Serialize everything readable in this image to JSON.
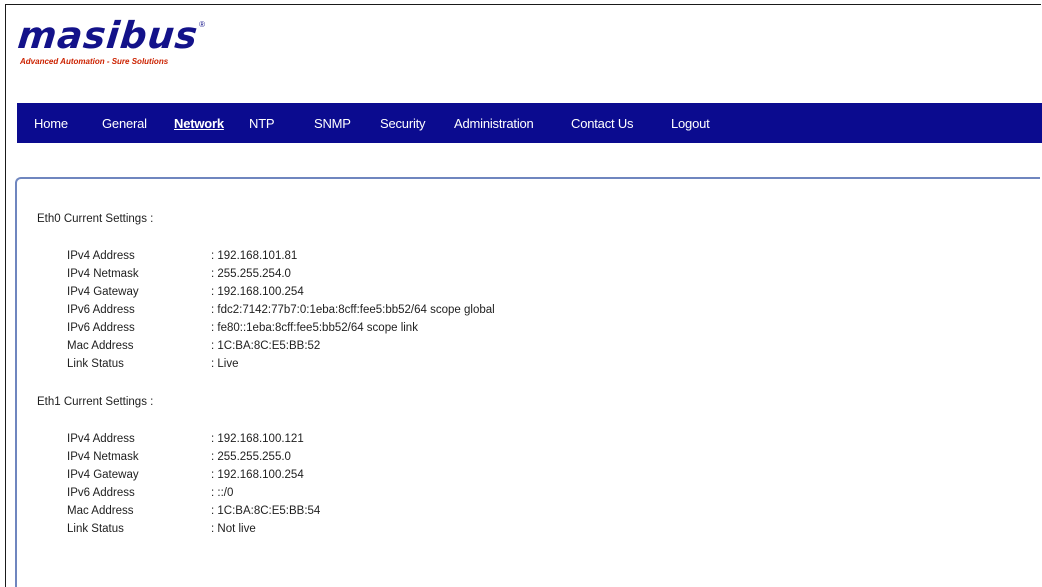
{
  "brand": {
    "name": "masibus",
    "reg": "®",
    "tagline": "Advanced Automation - Sure Solutions",
    "color": "#13128a",
    "tagline_color": "#cc2200"
  },
  "nav": {
    "background": "#0b0b8f",
    "items": [
      {
        "label": "Home",
        "active": false
      },
      {
        "label": "General",
        "active": false
      },
      {
        "label": "Network",
        "active": true
      },
      {
        "label": "NTP",
        "active": false
      },
      {
        "label": "SNMP",
        "active": false
      },
      {
        "label": "Security",
        "active": false
      },
      {
        "label": "Administration",
        "active": false
      },
      {
        "label": "Contact Us",
        "active": false
      },
      {
        "label": "Logout",
        "active": false
      }
    ]
  },
  "eth0": {
    "title": "Eth0 Current Settings :",
    "rows": [
      {
        "label": "IPv4 Address",
        "value": "192.168.101.81"
      },
      {
        "label": "IPv4 Netmask",
        "value": "255.255.254.0"
      },
      {
        "label": "IPv4 Gateway",
        "value": "192.168.100.254"
      },
      {
        "label": "IPv6 Address",
        "value": "fdc2:7142:77b7:0:1eba:8cff:fee5:bb52/64  scope global"
      },
      {
        "label": "IPv6 Address",
        "value": "fe80::1eba:8cff:fee5:bb52/64  scope link"
      },
      {
        "label": "Mac Address",
        "value": "1C:BA:8C:E5:BB:52"
      },
      {
        "label": "Link Status",
        "value": "Live"
      }
    ]
  },
  "eth1": {
    "title": "Eth1 Current Settings :",
    "rows": [
      {
        "label": "IPv4 Address",
        "value": "192.168.100.121"
      },
      {
        "label": "IPv4 Netmask",
        "value": "255.255.255.0"
      },
      {
        "label": "IPv4 Gateway",
        "value": "192.168.100.254"
      },
      {
        "label": "IPv6 Address",
        "value": "::/0"
      },
      {
        "label": "Mac Address",
        "value": "1C:BA:8C:E5:BB:54"
      },
      {
        "label": "Link Status",
        "value": "Not live"
      }
    ]
  }
}
